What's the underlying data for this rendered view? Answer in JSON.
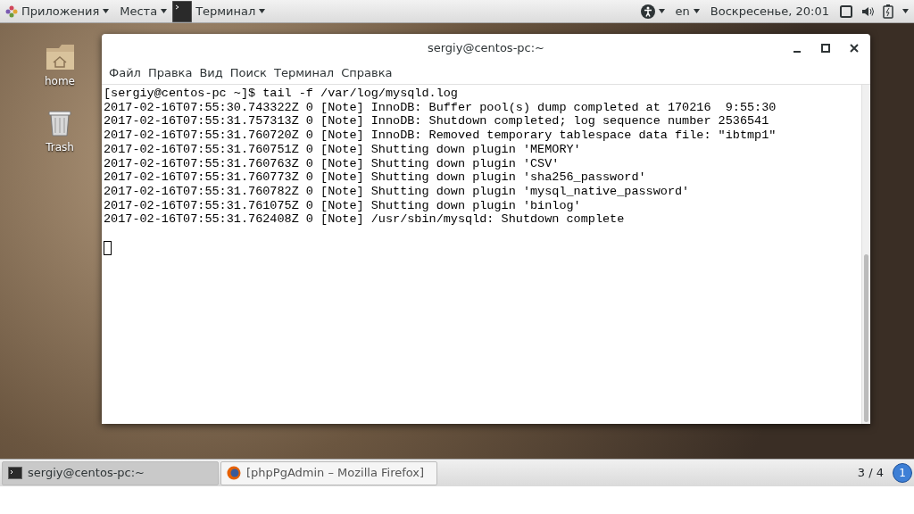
{
  "top_bar": {
    "apps_menu": "Приложения",
    "places_menu": "Места",
    "app_menu": "Терминал",
    "language": "en",
    "clock": "Воскресенье, 20:01"
  },
  "desktop_icons": [
    {
      "kind": "home",
      "label": "home"
    },
    {
      "kind": "trash",
      "label": "Trash"
    }
  ],
  "window": {
    "title": "sergiy@centos-pc:~",
    "menu": [
      "Файл",
      "Правка",
      "Вид",
      "Поиск",
      "Терминал",
      "Справка"
    ],
    "lines": [
      "[sergiy@centos-pc ~]$ tail -f /var/log/mysqld.log",
      "2017-02-16T07:55:30.743322Z 0 [Note] InnoDB: Buffer pool(s) dump completed at 170216  9:55:30",
      "2017-02-16T07:55:31.757313Z 0 [Note] InnoDB: Shutdown completed; log sequence number 2536541",
      "2017-02-16T07:55:31.760720Z 0 [Note] InnoDB: Removed temporary tablespace data file: \"ibtmp1\"",
      "2017-02-16T07:55:31.760751Z 0 [Note] Shutting down plugin 'MEMORY'",
      "2017-02-16T07:55:31.760763Z 0 [Note] Shutting down plugin 'CSV'",
      "2017-02-16T07:55:31.760773Z 0 [Note] Shutting down plugin 'sha256_password'",
      "2017-02-16T07:55:31.760782Z 0 [Note] Shutting down plugin 'mysql_native_password'",
      "2017-02-16T07:55:31.761075Z 0 [Note] Shutting down plugin 'binlog'",
      "2017-02-16T07:55:31.762408Z 0 [Note] /usr/sbin/mysqld: Shutdown complete"
    ]
  },
  "taskbar": {
    "tasks": [
      {
        "kind": "terminal",
        "label": "sergiy@centos-pc:~",
        "selected": true
      },
      {
        "kind": "browser",
        "label": "[phpPgAdmin – Mozilla Firefox]",
        "selected": false
      }
    ],
    "workspace": "3 / 4",
    "notifications": "1"
  }
}
